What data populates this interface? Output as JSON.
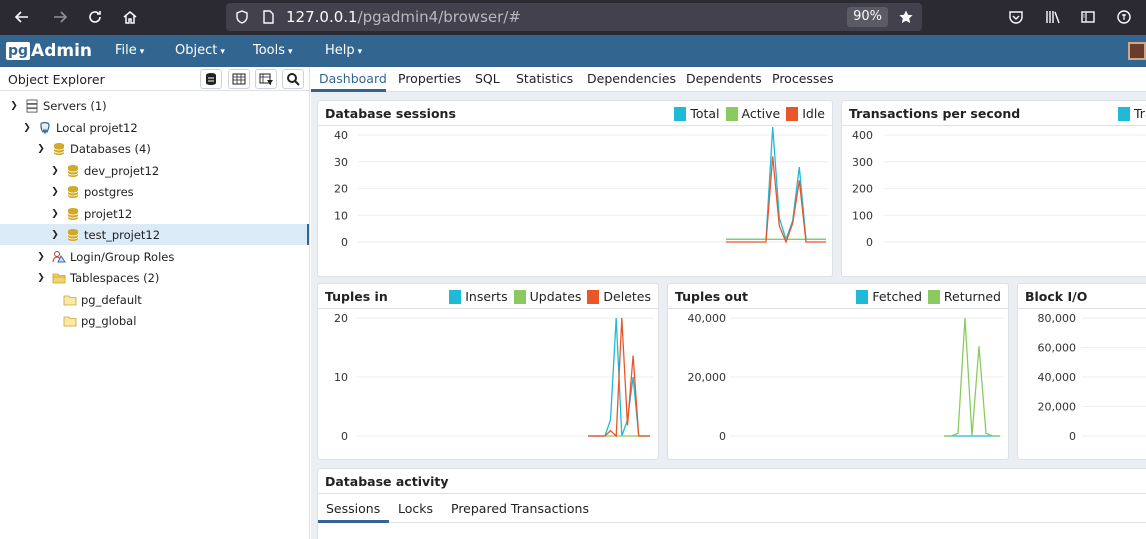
{
  "browser": {
    "url_host": "127.0.0.1",
    "url_path": "/pgadmin4/browser/#",
    "zoom": "90%"
  },
  "app": {
    "logo_pg": "pg",
    "logo_admin": "Admin",
    "menu": [
      "File",
      "Object",
      "Tools",
      "Help"
    ]
  },
  "explorer": {
    "title": "Object Explorer",
    "tree": [
      {
        "label": "Servers (1)",
        "icon": "servers-icon",
        "expanded": true
      },
      {
        "label": "Local projet12",
        "icon": "elephant-server-icon",
        "expanded": true
      },
      {
        "label": "Databases (4)",
        "icon": "databases-icon",
        "expanded": true
      },
      {
        "label": "dev_projet12",
        "icon": "database-icon",
        "expanded": false
      },
      {
        "label": "postgres",
        "icon": "database-icon",
        "expanded": false
      },
      {
        "label": "projet12",
        "icon": "database-icon",
        "expanded": false
      },
      {
        "label": "test_projet12",
        "icon": "database-icon",
        "expanded": false,
        "selected": true
      },
      {
        "label": "Login/Group Roles",
        "icon": "roles-icon",
        "expanded": false
      },
      {
        "label": "Tablespaces (2)",
        "icon": "tablespaces-icon",
        "expanded": true
      },
      {
        "label": "pg_default",
        "icon": "folder-icon"
      },
      {
        "label": "pg_global",
        "icon": "folder-icon"
      }
    ]
  },
  "tabs": [
    "Dashboard",
    "Properties",
    "SQL",
    "Statistics",
    "Dependencies",
    "Dependents",
    "Processes"
  ],
  "active_tab": "Dashboard",
  "colors": {
    "brand": "#326690",
    "series_cyan": "#1fbad6",
    "series_green": "#8bca5f",
    "series_orange": "#e8562a"
  },
  "activity": {
    "title": "Database activity",
    "subtabs": [
      "Sessions",
      "Locks",
      "Prepared Transactions"
    ],
    "active_subtab": "Sessions"
  },
  "chart_data": [
    {
      "id": "sessions",
      "type": "line",
      "title": "Database sessions",
      "yticks": [
        "40",
        "30",
        "20",
        "10",
        "0"
      ],
      "ylim": [
        0,
        40
      ],
      "series": [
        {
          "name": "Total",
          "color": "#1fbad6",
          "values": [
            1,
            1,
            1,
            1,
            1,
            1,
            1,
            43,
            9,
            1,
            8,
            28,
            1,
            1,
            1,
            1
          ]
        },
        {
          "name": "Active",
          "color": "#8bca5f",
          "values": [
            1,
            1,
            1,
            1,
            1,
            1,
            1,
            1,
            1,
            1,
            1,
            1,
            1,
            1,
            1,
            1
          ]
        },
        {
          "name": "Idle",
          "color": "#e8562a",
          "values": [
            0,
            0,
            0,
            0,
            0,
            0,
            0,
            32,
            6,
            0,
            7,
            23,
            0,
            0,
            0,
            0
          ]
        }
      ]
    },
    {
      "id": "tps",
      "type": "line",
      "title": "Transactions per second",
      "yticks": [
        "400",
        "300",
        "200",
        "100",
        "0"
      ],
      "ylim": [
        0,
        400
      ],
      "series": [
        {
          "name": "Tra",
          "color": "#1fbad6",
          "values": []
        }
      ]
    },
    {
      "id": "tuples_in",
      "type": "line",
      "title": "Tuples in",
      "yticks": [
        "20",
        "10",
        "0"
      ],
      "ylim": [
        0,
        22
      ],
      "series": [
        {
          "name": "Inserts",
          "color": "#1fbad6",
          "values": [
            0,
            0,
            0,
            0,
            3,
            22,
            0,
            3,
            11,
            0,
            0,
            0
          ]
        },
        {
          "name": "Updates",
          "color": "#8bca5f",
          "values": [
            0,
            0,
            0,
            0,
            0,
            0,
            0,
            0,
            0,
            0,
            0,
            0
          ]
        },
        {
          "name": "Deletes",
          "color": "#e8562a",
          "values": [
            0,
            0,
            0,
            0,
            1,
            0,
            22,
            2,
            15,
            0,
            0,
            0
          ]
        }
      ]
    },
    {
      "id": "tuples_out",
      "type": "line",
      "title": "Tuples out",
      "yticks": [
        "40,000",
        "20,000",
        "0"
      ],
      "ylim": [
        0,
        46000
      ],
      "series": [
        {
          "name": "Fetched",
          "color": "#1fbad6",
          "values": [
            0,
            0,
            0,
            0,
            0,
            0,
            0,
            0,
            0
          ]
        },
        {
          "name": "Returned",
          "color": "#8bca5f",
          "values": [
            0,
            0,
            1000,
            46000,
            0,
            35000,
            1000,
            0,
            0
          ]
        }
      ]
    },
    {
      "id": "block_io",
      "type": "line",
      "title": "Block I/O",
      "yticks": [
        "80,000",
        "60,000",
        "40,000",
        "20,000",
        "0"
      ],
      "ylim": [
        0,
        80000
      ],
      "series": []
    }
  ]
}
